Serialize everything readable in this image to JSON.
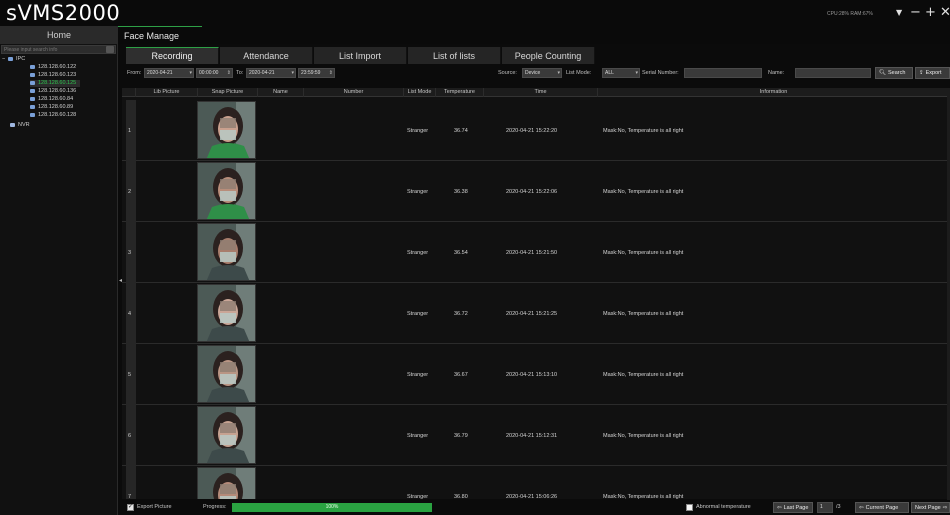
{
  "app": {
    "title": "sVMS2000",
    "sysinfo": "CPU:28%  RAM:67%",
    "controls": {
      "dropdown": "▼",
      "minimize": "−",
      "maximize": "+",
      "close": "✕"
    }
  },
  "main_tabs": {
    "home": "Home",
    "face": "Face Manage"
  },
  "sidebar": {
    "search_placeholder": "Please input search info",
    "tree": [
      {
        "label": "IPC",
        "toggle": "−",
        "icon": "camera-group-icon"
      },
      {
        "label": "128.128.60.122",
        "icon": "camera-icon"
      },
      {
        "label": "128.128.60.123",
        "icon": "camera-icon"
      },
      {
        "label": "128.128.60.125",
        "icon": "camera-icon"
      },
      {
        "label": "128.128.60.136",
        "icon": "camera-icon"
      },
      {
        "label": "128.128.60.84",
        "icon": "camera-icon"
      },
      {
        "label": "128.128.60.89",
        "icon": "camera-icon"
      },
      {
        "label": "128.128.60.128",
        "icon": "camera-icon"
      },
      {
        "label": "NVR",
        "icon": "nvr-icon"
      }
    ],
    "selected_index": 3,
    "collapse_arrow": "◀"
  },
  "sub_tabs": [
    "Recording",
    "Attendance",
    "List Import",
    "List of lists",
    "People Counting"
  ],
  "filters": {
    "from_label": "From:",
    "from_date": "2020-04-21",
    "from_time": "00:00:00",
    "to_label": "To:",
    "to_date": "2020-04-21",
    "to_time": "23:59:59",
    "source_label": "Source:",
    "source_value": "Device",
    "list_mode_label": "List Mode:",
    "list_mode_value": "ALL",
    "serial_label": "Serial Number:",
    "name_label": "Name:",
    "search_button": "Search",
    "export_button": "Export"
  },
  "table": {
    "headers": [
      "Lib Picture",
      "Snap Picture",
      "Name",
      "Number",
      "List Mode",
      "Temperature",
      "Time",
      "Information"
    ],
    "rows": [
      {
        "num": "1",
        "list_mode": "Stranger",
        "temperature": "36.74",
        "time": "2020-04-21 15:22:20",
        "info": "Mask:No, Temperature is all right"
      },
      {
        "num": "2",
        "list_mode": "Stranger",
        "temperature": "36.38",
        "time": "2020-04-21 15:22:06",
        "info": "Mask:No, Temperature is all right"
      },
      {
        "num": "3",
        "list_mode": "Stranger",
        "temperature": "36.54",
        "time": "2020-04-21 15:21:50",
        "info": "Mask:No, Temperature is all right"
      },
      {
        "num": "4",
        "list_mode": "Stranger",
        "temperature": "36.72",
        "time": "2020-04-21 15:21:25",
        "info": "Mask:No, Temperature is all right"
      },
      {
        "num": "5",
        "list_mode": "Stranger",
        "temperature": "36.67",
        "time": "2020-04-21 15:13:10",
        "info": "Mask:No, Temperature is all right"
      },
      {
        "num": "6",
        "list_mode": "Stranger",
        "temperature": "36.79",
        "time": "2020-04-21 15:12:31",
        "info": "Mask:No, Temperature is all right"
      },
      {
        "num": "7",
        "list_mode": "Stranger",
        "temperature": "36.80",
        "time": "2020-04-21 15:06:26",
        "info": "Mask:No, Temperature is all right"
      }
    ]
  },
  "footer": {
    "export_picture": "Export Picture",
    "progress_label": "Progress:",
    "progress_value": 1.0,
    "progress_text": "100%",
    "abnormal_label": "Abnormal temperature",
    "last_page": "Last Page",
    "page_input": "1",
    "page_total": "/3",
    "current_page": "Current Page",
    "next_page": "Next Page"
  },
  "colors": {
    "accent_green": "#2aa241",
    "selected_text": "#2fc44f",
    "background": "#0b0b0b"
  }
}
